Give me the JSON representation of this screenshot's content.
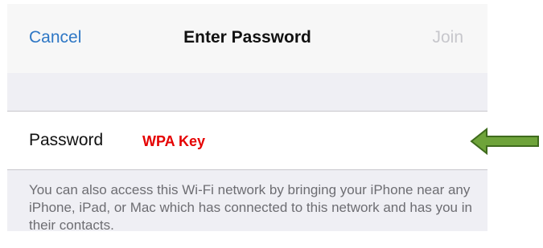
{
  "navbar": {
    "cancel_label": "Cancel",
    "title": "Enter Password",
    "join_label": "Join"
  },
  "password_cell": {
    "label": "Password",
    "value": "",
    "annotation": "WPA Key"
  },
  "footer": {
    "text": "You can also access this Wi-Fi network by bringing your iPhone near any iPhone, iPad, or Mac which has connected to this network and has you in their contacts."
  },
  "colors": {
    "accent": "#2e77c5",
    "disabled": "#c7c7cc",
    "annotation": "#e50000",
    "arrow_fill": "#6ea33a",
    "arrow_stroke": "#3f6b1d",
    "background": "#efeff4"
  },
  "icons": {
    "arrow": "left-arrow-icon"
  }
}
